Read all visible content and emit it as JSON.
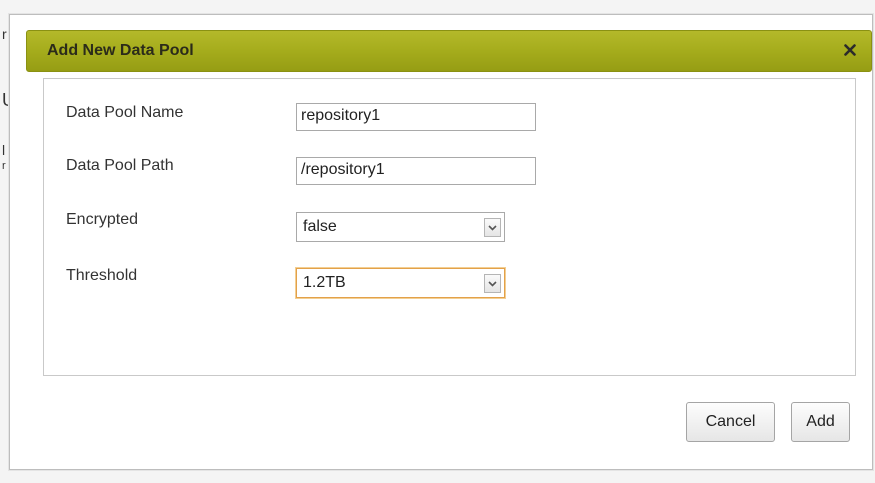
{
  "background": {
    "fragments": [
      "r",
      "U",
      "l",
      "r"
    ]
  },
  "dialog": {
    "title": "Add New Data Pool",
    "close_icon": "×",
    "fields": {
      "name": {
        "label": "Data Pool Name",
        "value": "repository1"
      },
      "path": {
        "label": "Data Pool Path",
        "value": "/repository1"
      },
      "encrypted": {
        "label": "Encrypted",
        "value": "false"
      },
      "threshold": {
        "label": "Threshold",
        "value": "1.2TB"
      }
    },
    "buttons": {
      "cancel": "Cancel",
      "add": "Add"
    }
  },
  "colors": {
    "titlebar": "#a5ac1c",
    "focus_border": "#e3a14a"
  }
}
